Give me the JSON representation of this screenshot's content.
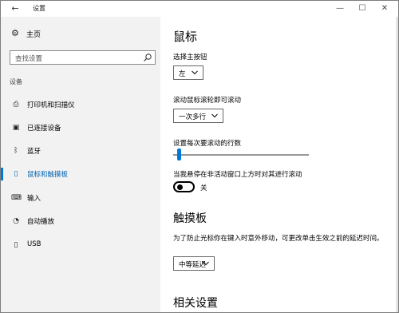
{
  "titlebar": {
    "back_icon": "back-arrow-icon",
    "title": "设置",
    "minimize": "—",
    "maximize": "☐",
    "close": "✕"
  },
  "sidebar": {
    "home_label": "主页",
    "search_placeholder": "查找设置",
    "section": "设备",
    "items": [
      {
        "label": "打印机和扫描仪",
        "icon": "printer-icon"
      },
      {
        "label": "已连接设备",
        "icon": "connected-devices-icon"
      },
      {
        "label": "蓝牙",
        "icon": "bluetooth-icon"
      },
      {
        "label": "鼠标和触摸板",
        "icon": "mouse-icon",
        "active": true
      },
      {
        "label": "输入",
        "icon": "keyboard-icon"
      },
      {
        "label": "自动播放",
        "icon": "autoplay-icon"
      },
      {
        "label": "USB",
        "icon": "usb-icon"
      }
    ]
  },
  "main": {
    "title": "鼠标",
    "primary_button_label": "选择主按钮",
    "primary_button_value": "左",
    "scroll_label": "滚动鼠标滚轮即可滚动",
    "scroll_value": "一次多行",
    "lines_label": "设置每次要滚动的行数",
    "lines_slider_fraction": 0.03,
    "inactive_scroll_label": "当我悬停在非活动窗口上方时对其进行滚动",
    "inactive_scroll_state": "关",
    "touchpad_title": "触摸板",
    "touchpad_desc": "为了防止光标你在键入时意外移动，可更改单击生效之前的延迟时间。",
    "touchpad_delay_value": "中等延迟",
    "related_title": "相关设置"
  },
  "colors": {
    "accent": "#0078d7",
    "sidebar_bg": "#f2f2f2"
  }
}
